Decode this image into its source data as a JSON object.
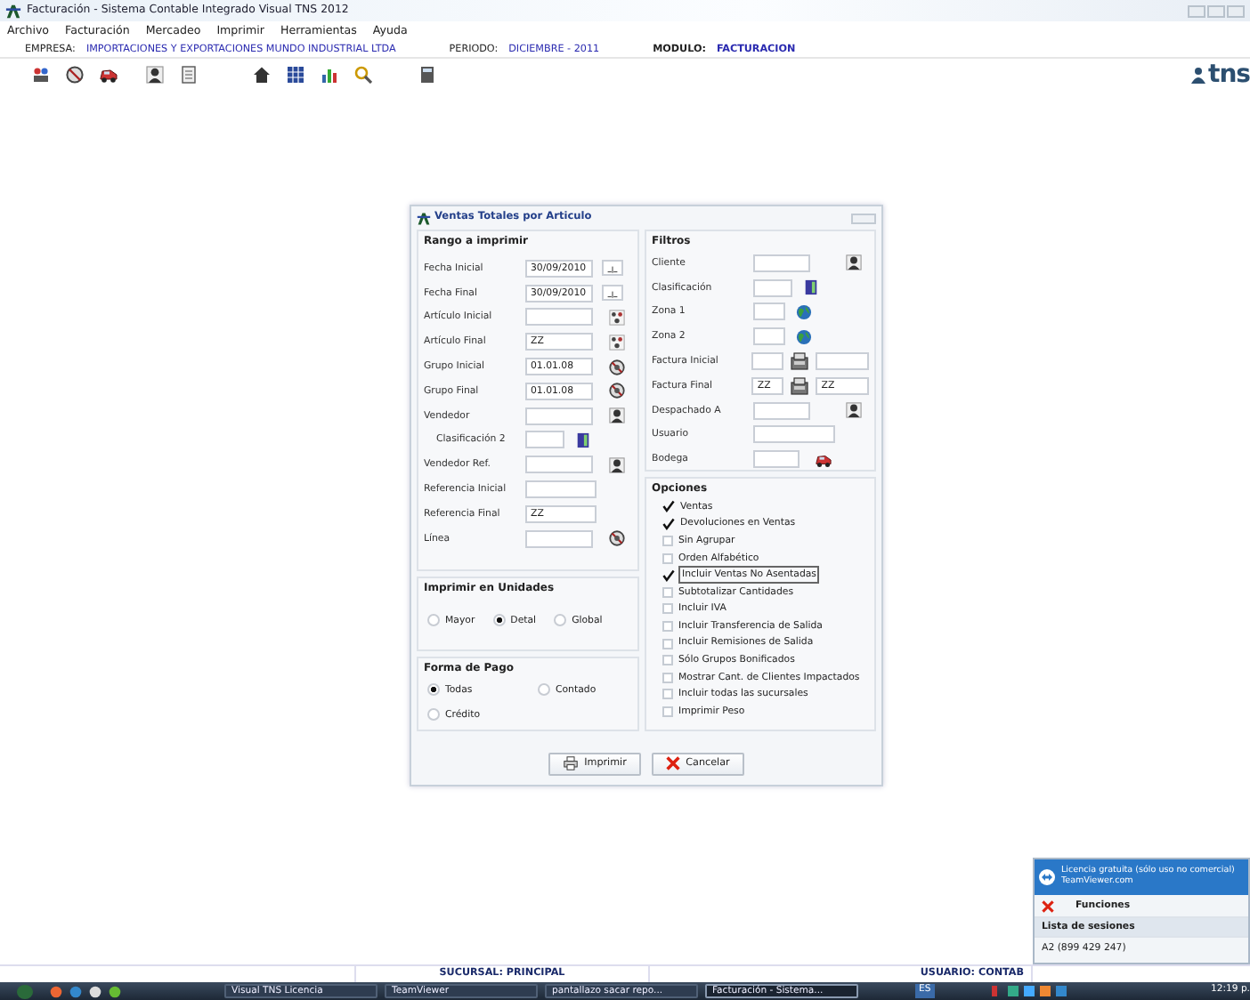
{
  "window": {
    "title": "Facturación - Sistema Contable Integrado Visual TNS 2012"
  },
  "menu": [
    "Archivo",
    "Facturación",
    "Mercadeo",
    "Imprimir",
    "Herramientas",
    "Ayuda"
  ],
  "info": [
    {
      "label": "EMPRESA:",
      "value": "IMPORTACIONES Y EXPORTACIONES MUNDO INDUSTRIAL LTDA"
    },
    {
      "label": "PERIODO:",
      "value": "DICIEMBRE - 2011"
    },
    {
      "label": "MODULO:",
      "value": "FACTURACION"
    }
  ],
  "logo": "tns",
  "dialog": {
    "title": "Ventas Totales por Articulo",
    "range": {
      "title": "Rango a imprimir",
      "fields": [
        {
          "label": "Fecha Inicial",
          "value": "30/09/2010",
          "kind": "date"
        },
        {
          "label": "Fecha Final",
          "value": "30/09/2010",
          "kind": "date"
        },
        {
          "label": "Artículo Inicial",
          "kind": "grid"
        },
        {
          "label": "Artículo Final",
          "value": "ZZ",
          "kind": "grid"
        },
        {
          "label": "Grupo Inicial",
          "value": "01.01.08",
          "kind": "disc"
        },
        {
          "label": "Grupo Final",
          "value": "01.01.08",
          "kind": "disc"
        },
        {
          "label": "Vendedor",
          "kind": "person"
        },
        {
          "label": "Clasificación 2",
          "kind": "book",
          "indented": true
        },
        {
          "label": "Vendedor Ref.",
          "kind": "person"
        },
        {
          "label": "Referencia Inicial",
          "kind": "plain"
        },
        {
          "label": "Referencia Final",
          "value": "ZZ",
          "kind": "plain"
        },
        {
          "label": "Línea",
          "kind": "disc"
        }
      ]
    },
    "filters": {
      "title": "Filtros",
      "fields": [
        {
          "label": "Cliente",
          "kind": "person"
        },
        {
          "label": "Clasificación",
          "kind": "book"
        },
        {
          "label": "Zona 1",
          "kind": "globe"
        },
        {
          "label": "Zona 2",
          "kind": "globe"
        },
        {
          "label": "Factura Inicial",
          "kind": "register"
        },
        {
          "label": "Factura Final",
          "value": "ZZ",
          "value2": "ZZ",
          "kind": "register"
        },
        {
          "label": "Despachado A",
          "kind": "person"
        },
        {
          "label": "Usuario",
          "kind": "plain"
        },
        {
          "label": "Bodega",
          "kind": "truck"
        }
      ]
    },
    "options": {
      "title": "Opciones",
      "items": [
        {
          "label": "Ventas",
          "checked": true
        },
        {
          "label": "Devoluciones en Ventas",
          "checked": true
        },
        {
          "label": "Sin Agrupar",
          "checked": false
        },
        {
          "label": "Orden Alfabético",
          "checked": false
        },
        {
          "label": "Incluir Ventas No Asentadas",
          "checked": true,
          "focused": true
        },
        {
          "label": "Subtotalizar Cantidades",
          "checked": false
        },
        {
          "label": "Incluir IVA",
          "checked": false
        },
        {
          "label": "Incluir Transferencia de Salida",
          "checked": false
        },
        {
          "label": "Incluir Remisiones de Salida",
          "checked": false
        },
        {
          "label": "Sólo Grupos Bonificados",
          "checked": false
        },
        {
          "label": "Mostrar Cant. de Clientes Impactados",
          "checked": false
        },
        {
          "label": "Incluir todas las sucursales",
          "checked": false
        },
        {
          "label": "Imprimir Peso",
          "checked": false
        }
      ]
    },
    "units": {
      "title": "Imprimir en Unidades",
      "options": [
        {
          "label": "Mayor",
          "selected": false
        },
        {
          "label": "Detal",
          "selected": true
        },
        {
          "label": "Global",
          "selected": false
        }
      ]
    },
    "payment": {
      "title": "Forma de Pago",
      "options": [
        {
          "label": "Todas",
          "selected": true
        },
        {
          "label": "Contado",
          "selected": false
        },
        {
          "label": "Crédito",
          "selected": false
        }
      ]
    },
    "buttons": [
      {
        "label": "Imprimir",
        "kind": "print"
      },
      {
        "label": "Cancelar",
        "kind": "cancel"
      }
    ]
  },
  "status_bar": [
    "SUCURSAL: PRINCIPAL",
    "USUARIO: CONTAB"
  ],
  "teamviewer": {
    "banner": "Licencia gratuita (sólo uso no comercial)",
    "site": "TeamViewer.com",
    "functions": "Funciones",
    "sessions_title": "Lista de sesiones",
    "session": "A2 (899 429 247)"
  },
  "taskbar": {
    "tasks": [
      {
        "label": "Visual TNS Licencia",
        "selected": false
      },
      {
        "label": "TeamViewer",
        "selected": false
      },
      {
        "label": "pantallazo sacar repo...",
        "selected": false
      },
      {
        "label": "Facturación - Sistema...",
        "selected": true
      }
    ],
    "language": "ES",
    "clock": "12:19 p."
  }
}
